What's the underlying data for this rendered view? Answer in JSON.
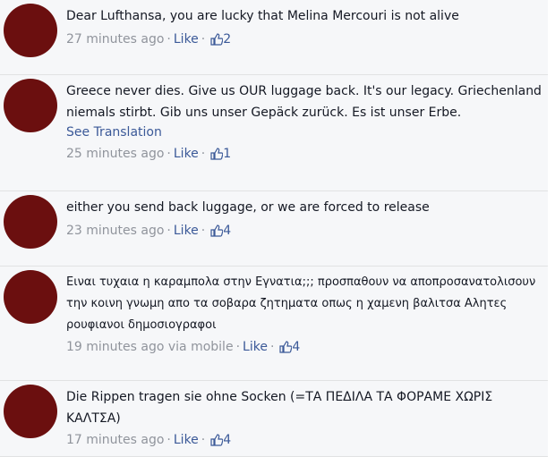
{
  "comments": [
    {
      "text": "Dear Lufthansa, you are lucky that Melina Mercouri is not alive",
      "time": "27 minutes ago",
      "like_label": "Like",
      "like_count": "2"
    },
    {
      "text": "Greece never dies. Give us OUR luggage back. It's our legacy. Griechenland niemals stirbt. Gib uns unser Gepäck zurück. Es ist unser Erbe.",
      "see_translation": "See Translation",
      "time": "25 minutes ago",
      "like_label": "Like",
      "like_count": "1"
    },
    {
      "text_a": "either you send back",
      "text_b": "luggage, or we are forced to release",
      "time": "23 minutes ago",
      "like_label": "Like",
      "like_count": "4"
    },
    {
      "text_a": "Ειναι τυχαια η καραμπολα στην Εγνατια;;; προσπαθουν να αποπροσανατολισουν την κοινη γνωμη απο τα σοβαρα ζητηματα οπως η χαμενη βαλιτσα",
      "text_b": "Αλητες ρουφιανοι δημοσιογραφοι",
      "time": "19 minutes ago",
      "via": "via mobile",
      "like_label": "Like",
      "like_count": "4"
    },
    {
      "text": "Die Rippen tragen sie ohne Socken (=ΤΑ ΠΕΔΙΛΑ ΤΑ ΦΟΡΑΜΕ ΧΩΡΙΣ ΚΑΛΤΣΑ)",
      "time": "17 minutes ago",
      "like_label": "Like",
      "like_count": "4"
    }
  ],
  "icons": {
    "avatar": "avatar-redacted",
    "like": "thumbs-up-icon"
  },
  "colors": {
    "link": "#3b5998",
    "meta": "#90949c",
    "redaction": "#7a0d12",
    "avatar": "#6b0f0f"
  }
}
